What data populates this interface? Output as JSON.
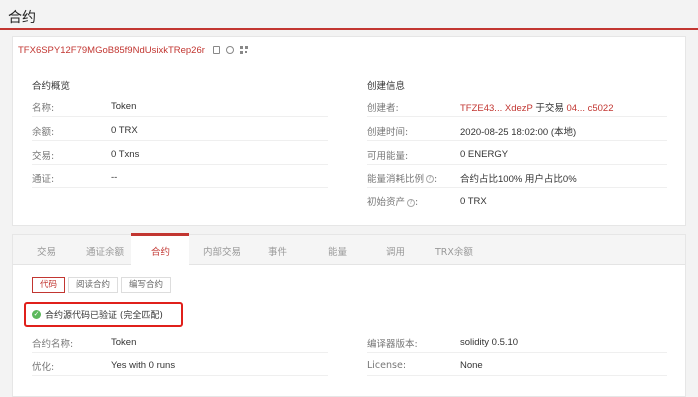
{
  "page": {
    "title": "合约"
  },
  "contract": {
    "address": "TFX6SPY12F79MGoB85f9NdUsixkTRep26r",
    "icons": [
      "copy-icon",
      "scan-icon",
      "qr-code-icon"
    ]
  },
  "overview": {
    "title": "合约概览",
    "name_label": "名称:",
    "name_value": "Token",
    "balance_label": "余额:",
    "balance_value": "0 TRX",
    "txns_label": "交易:",
    "txns_value": "0 Txns",
    "token_label": "通证:",
    "token_value": "--"
  },
  "creation": {
    "title": "创建信息",
    "creator_label": "创建者:",
    "creator_address": "TFZE43... XdezP",
    "creator_mid": " 于交易 ",
    "creator_tx": "04... c5022",
    "time_label": "创建时间:",
    "time_value": "2020-08-25 18:02:00 (本地)",
    "energy_label": "可用能量:",
    "energy_value": "0 ENERGY",
    "ratio_label": "能量消耗比例",
    "ratio_value": "合约占比100%  用户占比0%",
    "initial_label": "初始资产",
    "initial_value": "0 TRX"
  },
  "tabs": [
    "交易",
    "通证余额",
    "合约",
    "内部交易",
    "事件",
    "能量",
    "调用",
    "TRX余额"
  ],
  "active_tab": "合约",
  "subtabs": [
    "代码",
    "阅读合约",
    "编写合约"
  ],
  "verify": {
    "text": "合约源代码已验证 (完全匹配)"
  },
  "details": {
    "name_label": "合约名称:",
    "name_value": "Token",
    "opt_label": "优化:",
    "opt_value": "Yes with 0 runs",
    "compiler_label": "编译器版本:",
    "compiler_value": "solidity 0.5.10",
    "license_label": "License:",
    "license_value": "None"
  },
  "colors": {
    "accent": "#c23631",
    "highlight_box": "#e0201b",
    "verified": "#5cb85c"
  }
}
